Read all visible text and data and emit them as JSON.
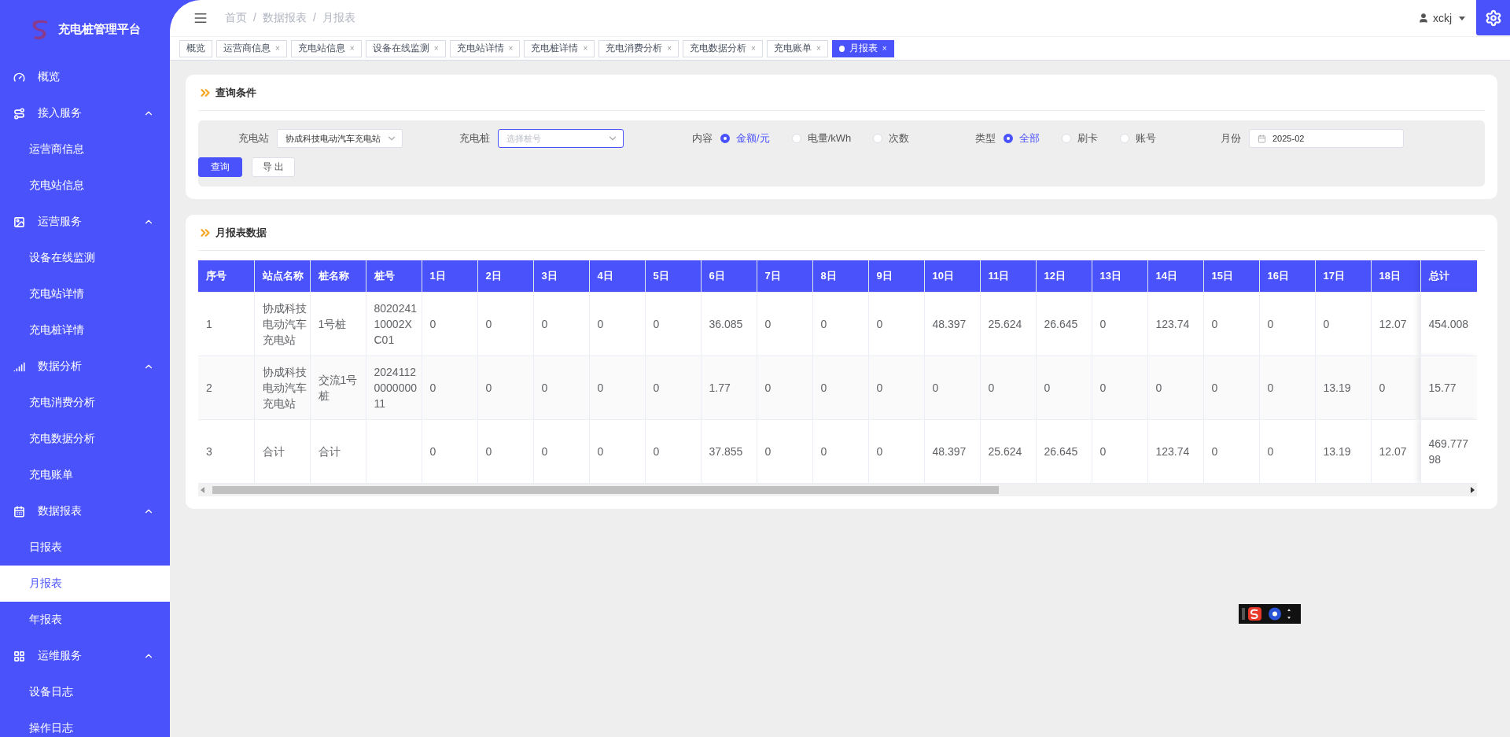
{
  "sidebar": {
    "title": "充电桩管理平台",
    "groups": [
      {
        "label": "概览"
      },
      {
        "label": "接入服务",
        "expanded": true,
        "children": [
          {
            "label": "运营商信息",
            "selected": false
          },
          {
            "label": "充电站信息",
            "selected": false
          }
        ]
      },
      {
        "label": "运营服务",
        "expanded": true,
        "children": [
          {
            "label": "设备在线监测",
            "selected": false
          },
          {
            "label": "充电站详情",
            "selected": false
          },
          {
            "label": "充电桩详情",
            "selected": false
          }
        ]
      },
      {
        "label": "数据分析",
        "expanded": true,
        "children": [
          {
            "label": "充电消费分析",
            "selected": false
          },
          {
            "label": "充电数据分析",
            "selected": false
          },
          {
            "label": "充电账单",
            "selected": false
          }
        ]
      },
      {
        "label": "数据报表",
        "expanded": true,
        "children": [
          {
            "label": "日报表",
            "selected": false
          },
          {
            "label": "月报表",
            "selected": true
          },
          {
            "label": "年报表",
            "selected": false
          }
        ]
      },
      {
        "label": "运维服务",
        "expanded": true,
        "children": [
          {
            "label": "设备日志",
            "selected": false
          },
          {
            "label": "操作日志",
            "selected": false
          }
        ]
      }
    ]
  },
  "breadcrumb": {
    "separator": "/",
    "items": [
      "首页",
      "数据报表",
      "月报表"
    ]
  },
  "user": {
    "name": "xckj"
  },
  "tabs": [
    {
      "label": "概览",
      "selected": false
    },
    {
      "label": "运营商信息",
      "selected": false,
      "close": "×"
    },
    {
      "label": "充电站信息",
      "selected": false,
      "close": "×"
    },
    {
      "label": "设备在线监测",
      "selected": false,
      "close": "×"
    },
    {
      "label": "充电站详情",
      "selected": false,
      "close": "×"
    },
    {
      "label": "充电桩详情",
      "selected": false,
      "close": "×"
    },
    {
      "label": "充电消费分析",
      "selected": false,
      "close": "×"
    },
    {
      "label": "充电数据分析",
      "selected": false,
      "close": "×"
    },
    {
      "label": "充电账单",
      "selected": false,
      "close": "×"
    },
    {
      "label": "月报表",
      "selected": true,
      "close": "×"
    }
  ],
  "query": {
    "title": "查询条件",
    "station": {
      "label": "充电站",
      "value": "协成科技电动汽车充电站"
    },
    "pile": {
      "label": "充电桩",
      "placeholder": "选择桩号"
    },
    "content": {
      "label": "内容",
      "options": [
        {
          "label": "金额/元",
          "selected": true
        },
        {
          "label": "电量/kWh",
          "selected": false
        },
        {
          "label": "次数",
          "selected": false
        }
      ]
    },
    "type": {
      "label": "类型",
      "options": [
        {
          "label": "全部",
          "selected": true
        },
        {
          "label": "刷卡",
          "selected": false
        },
        {
          "label": "账号",
          "selected": false
        }
      ]
    },
    "month": {
      "label": "月份",
      "value": "2025-02"
    },
    "buttons": [
      "查询",
      "导 出"
    ]
  },
  "report": {
    "title": "月报表数据",
    "columns": [
      "序号",
      "站点名称",
      "桩名称",
      "桩号",
      "1日",
      "2日",
      "3日",
      "4日",
      "5日",
      "6日",
      "7日",
      "8日",
      "9日",
      "10日",
      "11日",
      "12日",
      "13日",
      "14日",
      "15日",
      "16日",
      "17日",
      "18日",
      "总计"
    ],
    "rows": [
      [
        "1",
        "协成科技电动汽车充电站",
        "1号桩",
        "802024110002XC01",
        "0",
        "0",
        "0",
        "0",
        "0",
        "36.085",
        "0",
        "0",
        "0",
        "48.397",
        "25.624",
        "26.645",
        "0",
        "123.74",
        "0",
        "0",
        "0",
        "12.07",
        "454.008"
      ],
      [
        "2",
        "协成科技电动汽车充电站",
        "交流1号桩",
        "2024112000000011",
        "0",
        "0",
        "0",
        "0",
        "0",
        "1.77",
        "0",
        "0",
        "0",
        "0",
        "0",
        "0",
        "0",
        "0",
        "0",
        "0",
        "13.19",
        "0",
        "15.77"
      ],
      [
        "3",
        "合计",
        "合计",
        null,
        "0",
        "0",
        "0",
        "0",
        "0",
        "37.855",
        "0",
        "0",
        "0",
        "48.397",
        "25.624",
        "26.645",
        "0",
        "123.74",
        "0",
        "0",
        "13.19",
        "12.07",
        "469.77798"
      ]
    ]
  }
}
